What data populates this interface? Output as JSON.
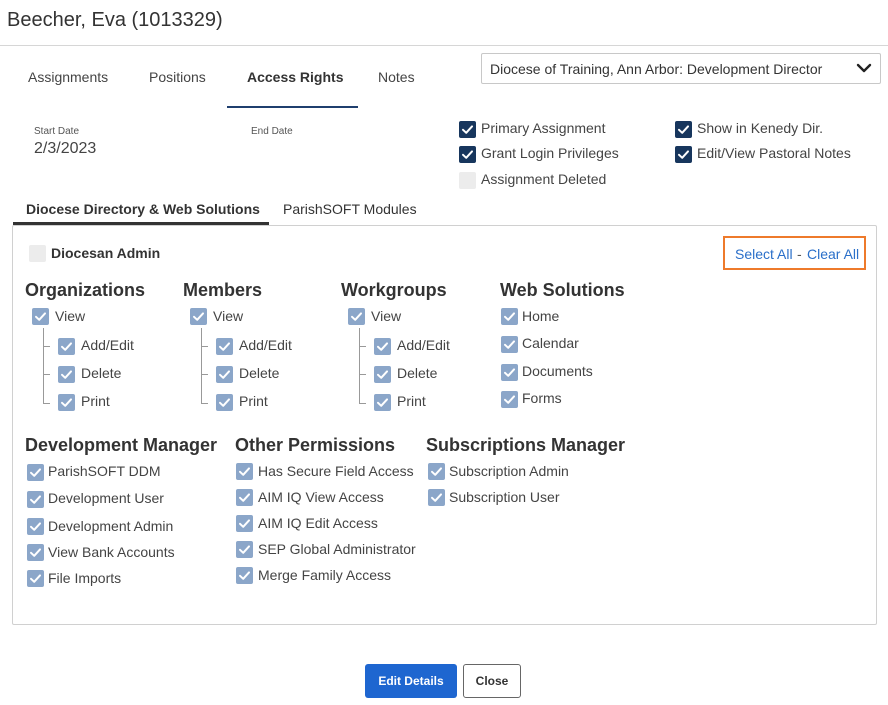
{
  "header": {
    "title": "Beecher, Eva (1013329)"
  },
  "tabs": [
    "Assignments",
    "Positions",
    "Access Rights",
    "Notes"
  ],
  "assignment_select": {
    "value": "Diocese of Training, Ann Arbor: Development Director"
  },
  "dates": {
    "start_label": "Start Date",
    "start_value": "2/3/2023",
    "end_label": "End Date",
    "end_value": ""
  },
  "flags": {
    "primary_assignment": {
      "label": "Primary Assignment",
      "checked": true
    },
    "grant_login": {
      "label": "Grant Login Privileges",
      "checked": true
    },
    "assignment_deleted": {
      "label": "Assignment Deleted",
      "checked": false
    },
    "show_kenedy": {
      "label": "Show in Kenedy Dir.",
      "checked": true
    },
    "pastoral_notes": {
      "label": "Edit/View Pastoral Notes",
      "checked": true
    }
  },
  "subtabs": [
    "Diocese Directory & Web Solutions",
    "ParishSOFT Modules"
  ],
  "diocesan_admin": {
    "label": "Diocesan Admin",
    "checked": false
  },
  "select_all": {
    "select": "Select All",
    "sep": "-",
    "clear": "Clear All"
  },
  "groups": {
    "organizations": {
      "title": "Organizations",
      "items": [
        "View",
        "Add/Edit",
        "Delete",
        "Print"
      ]
    },
    "members": {
      "title": "Members",
      "items": [
        "View",
        "Add/Edit",
        "Delete",
        "Print"
      ]
    },
    "workgroups": {
      "title": "Workgroups",
      "items": [
        "View",
        "Add/Edit",
        "Delete",
        "Print"
      ]
    },
    "web_solutions": {
      "title": "Web Solutions",
      "items": [
        "Home",
        "Calendar",
        "Documents",
        "Forms"
      ]
    },
    "development_manager": {
      "title": "Development Manager",
      "items": [
        "ParishSOFT DDM",
        "Development User",
        "Development Admin",
        "View Bank Accounts",
        "File Imports"
      ]
    },
    "other_permissions": {
      "title": "Other Permissions",
      "items": [
        "Has Secure Field Access",
        "AIM IQ View Access",
        "AIM IQ Edit Access",
        "SEP Global Administrator",
        "Merge Family Access"
      ]
    },
    "subscriptions_manager": {
      "title": "Subscriptions Manager",
      "items": [
        "Subscription Admin",
        "Subscription User"
      ]
    }
  },
  "buttons": {
    "edit": "Edit Details",
    "close": "Close"
  },
  "colors": {
    "navy_check": "#17365d",
    "light_check": "#8ba6c9",
    "link": "#2a6fc9",
    "highlight": "#ee7a2b",
    "primary_button": "#1e66d0"
  }
}
